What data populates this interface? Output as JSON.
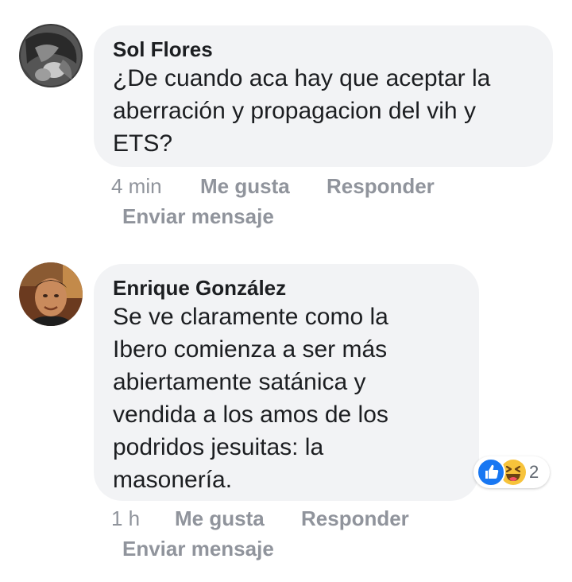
{
  "comments": [
    {
      "author": "Sol Flores",
      "lines": [
        "¿De cuando aca hay que aceptar la",
        "aberración y propagacion del vih y",
        "ETS?"
      ],
      "time": "4 min",
      "like_label": "Me gusta",
      "reply_label": "Responder",
      "message_label": "Enviar mensaje"
    },
    {
      "author": "Enrique González",
      "lines": [
        "Se ve claramente como la",
        "Ibero comienza a ser más",
        "abiertamente satánica y",
        "vendida a los amos de los",
        "podridos jesuitas: la",
        "masonería."
      ],
      "time": "1 h",
      "like_label": "Me gusta",
      "reply_label": "Responder",
      "message_label": "Enviar mensaje",
      "reactions": {
        "icons": [
          "like-icon",
          "haha-icon"
        ],
        "count": "2"
      }
    }
  ],
  "colors": {
    "bubble": "#f2f3f5",
    "text": "#1c1e21",
    "meta": "#90949c",
    "like_blue": "#1877f2",
    "haha_yellow": "#f7c33b"
  }
}
